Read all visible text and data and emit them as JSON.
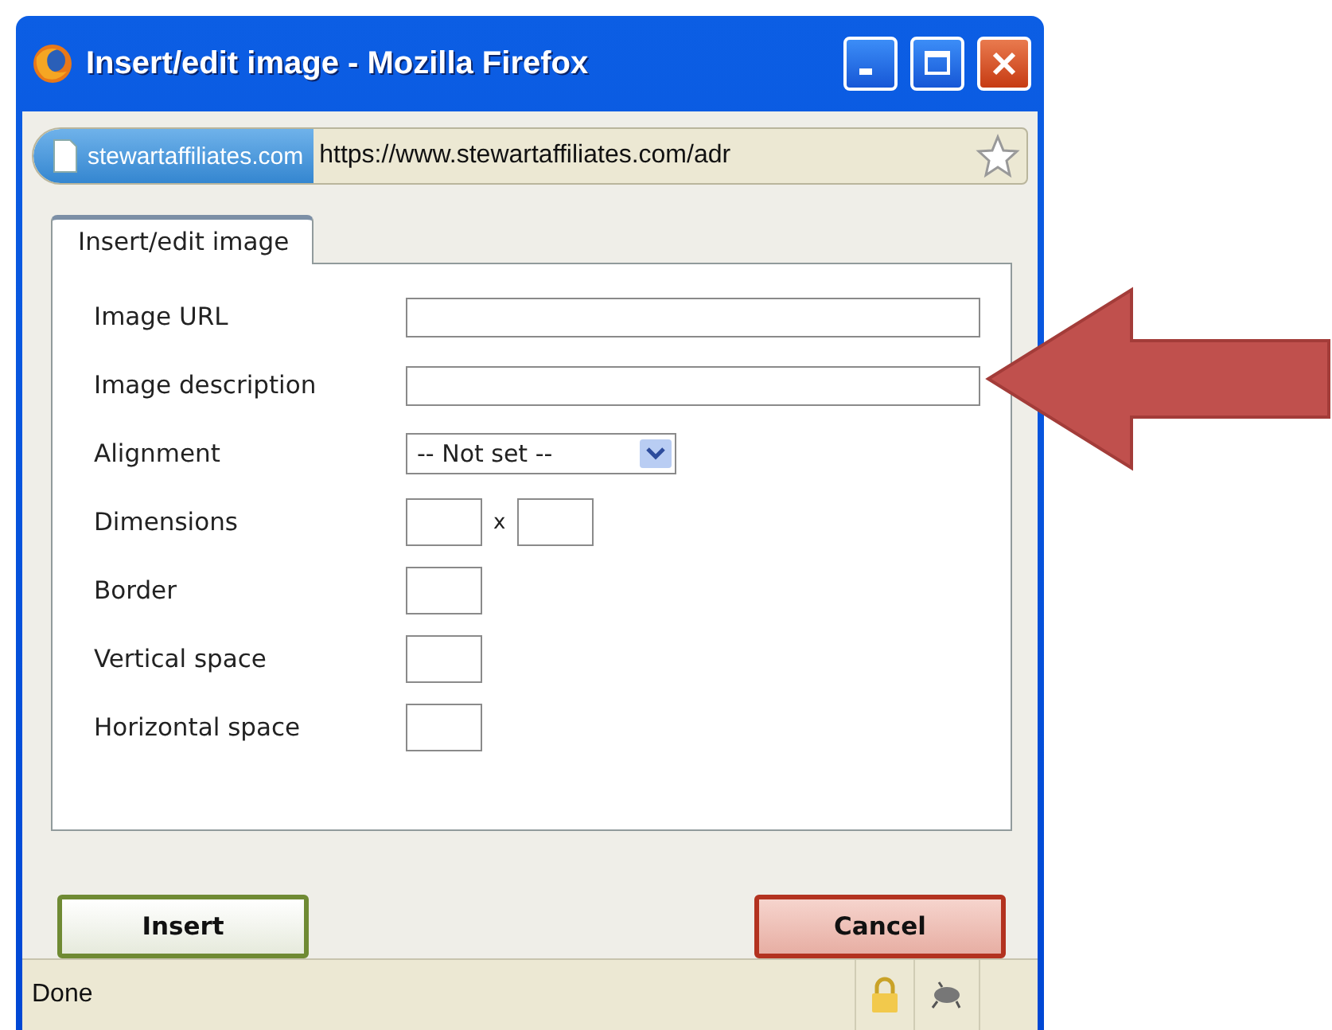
{
  "window": {
    "title": "Insert/edit image - Mozilla Firefox"
  },
  "address_bar": {
    "site": "stewartaffiliates.com",
    "url": "https://www.stewartaffiliates.com/adr"
  },
  "tabs": [
    {
      "label": "Insert/edit image",
      "selected": true
    }
  ],
  "fields": [
    {
      "kind": "text",
      "label": "Image URL"
    },
    {
      "kind": "text",
      "label": "Image description"
    },
    {
      "kind": "select",
      "label": "Alignment",
      "value": "-- Not set --"
    },
    {
      "kind": "pair",
      "label": "Dimensions",
      "separator": "x"
    },
    {
      "kind": "small",
      "label": "Border"
    },
    {
      "kind": "small",
      "label": "Vertical space"
    },
    {
      "kind": "small",
      "label": "Horizontal space"
    }
  ],
  "buttons": [
    {
      "kind": "confirm",
      "label": "Insert"
    },
    {
      "kind": "cancel",
      "label": "Cancel"
    }
  ],
  "status_bar": {
    "text": "Done"
  }
}
